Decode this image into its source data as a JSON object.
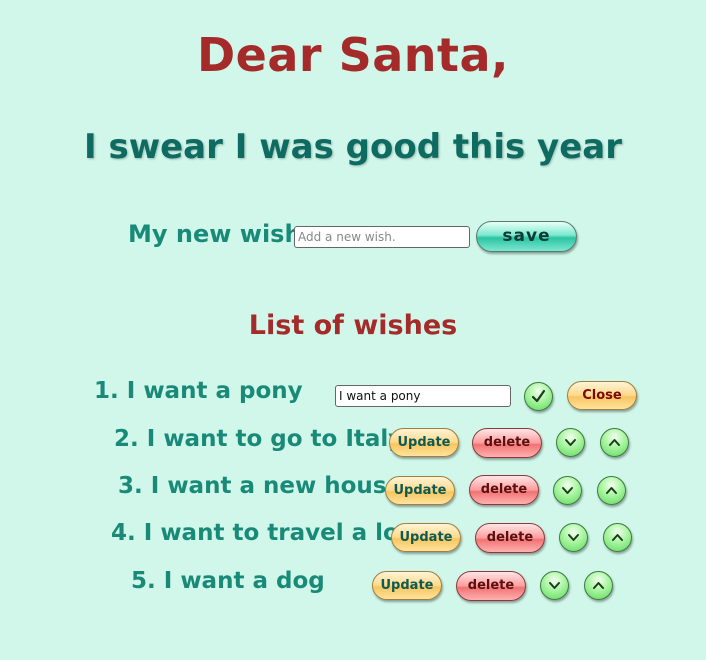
{
  "header": {
    "title": "Dear Santa,",
    "subtitle": "I swear I was good this year"
  },
  "new_wish": {
    "label": "My new wish:",
    "placeholder": "Add a new wish.",
    "save_label": "save"
  },
  "list": {
    "title": "List of wishes",
    "items": [
      {
        "text": "1. I want a pony",
        "edit_value": "I want a pony",
        "close_label": "Close",
        "mode": "editing"
      },
      {
        "text": "2. I want to go to Italy",
        "update_label": "Update",
        "delete_label": "delete"
      },
      {
        "text": "3. I want a new house",
        "update_label": "Update",
        "delete_label": "delete"
      },
      {
        "text": "4. I want to travel a lot",
        "update_label": "Update",
        "delete_label": "delete"
      },
      {
        "text": "5. I want a dog",
        "update_label": "Update",
        "delete_label": "delete"
      }
    ]
  },
  "icons": {
    "confirm": "check-icon",
    "move_down": "chevron-down-icon",
    "move_up": "chevron-up-icon"
  },
  "colors": {
    "background": "#d0f7ea",
    "title": "#a52a2a",
    "subtitle": "#0d6b62",
    "text": "#1a8a78"
  }
}
